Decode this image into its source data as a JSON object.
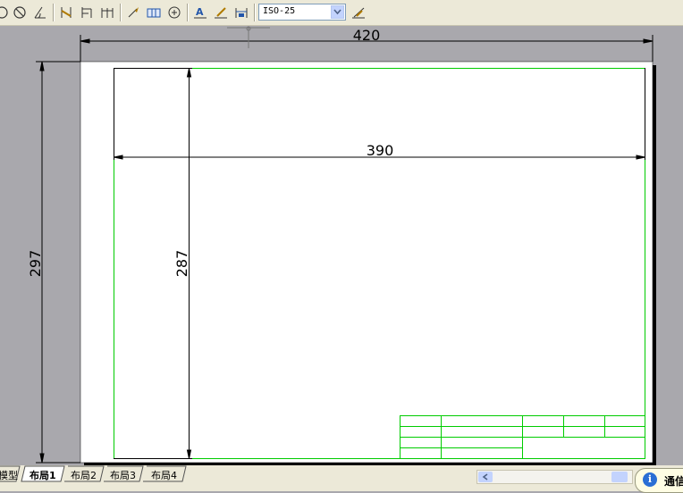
{
  "toolbar": {
    "dimension_style": "ISO-25",
    "icons": [
      "zoom-icon",
      "no-symbol-icon",
      "angle-icon",
      "quick-leader-icon",
      "baseline-icon",
      "continue-dim-icon",
      "leader-icon",
      "tolerance-icon",
      "center-mark-icon",
      "dim-edit-icon",
      "dim-text-edit-icon",
      "dim-update-icon",
      "dim-style-icon"
    ]
  },
  "drawing": {
    "sheet_width_label": "420",
    "sheet_height_label": "297",
    "frame_width_label": "390",
    "frame_height_label": "287",
    "colors": {
      "frame": "#00cc00",
      "sheet": "#ffffff",
      "background": "#a9a8ad",
      "dimension": "#000000"
    }
  },
  "tabs": {
    "items": [
      {
        "label": "模型",
        "active": false
      },
      {
        "label": "布局1",
        "active": true
      },
      {
        "label": "布局2",
        "active": false
      },
      {
        "label": "布局3",
        "active": false
      },
      {
        "label": "布局4",
        "active": false
      }
    ]
  },
  "status": {
    "balloon_text": "通信"
  }
}
